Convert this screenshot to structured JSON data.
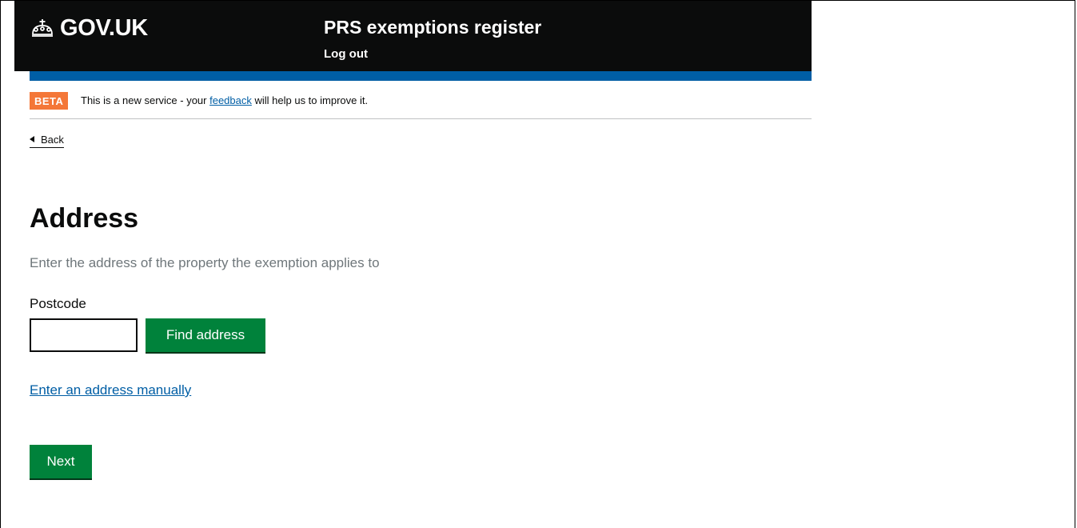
{
  "header": {
    "logo_text": "GOV.UK",
    "service_name": "PRS exemptions register",
    "logout_label": "Log out"
  },
  "phase_banner": {
    "tag": "BETA",
    "text_before": "This is a new service - your ",
    "link_text": "feedback",
    "text_after": " will help us to improve it."
  },
  "back_link": {
    "label": "Back"
  },
  "main": {
    "title": "Address",
    "hint": "Enter the address of the property the exemption applies to",
    "postcode_label": "Postcode",
    "postcode_value": "",
    "find_address_label": "Find address",
    "manual_link_label": "Enter an address manually",
    "next_label": "Next"
  },
  "colors": {
    "header_bg": "#0b0c0c",
    "header_bar": "#005ea5",
    "beta_tag": "#f47738",
    "link": "#005ea5",
    "button": "#00823b",
    "hint_text": "#6f777b"
  },
  "icons": {
    "logo": "crown-icon",
    "back": "back-triangle-icon"
  }
}
